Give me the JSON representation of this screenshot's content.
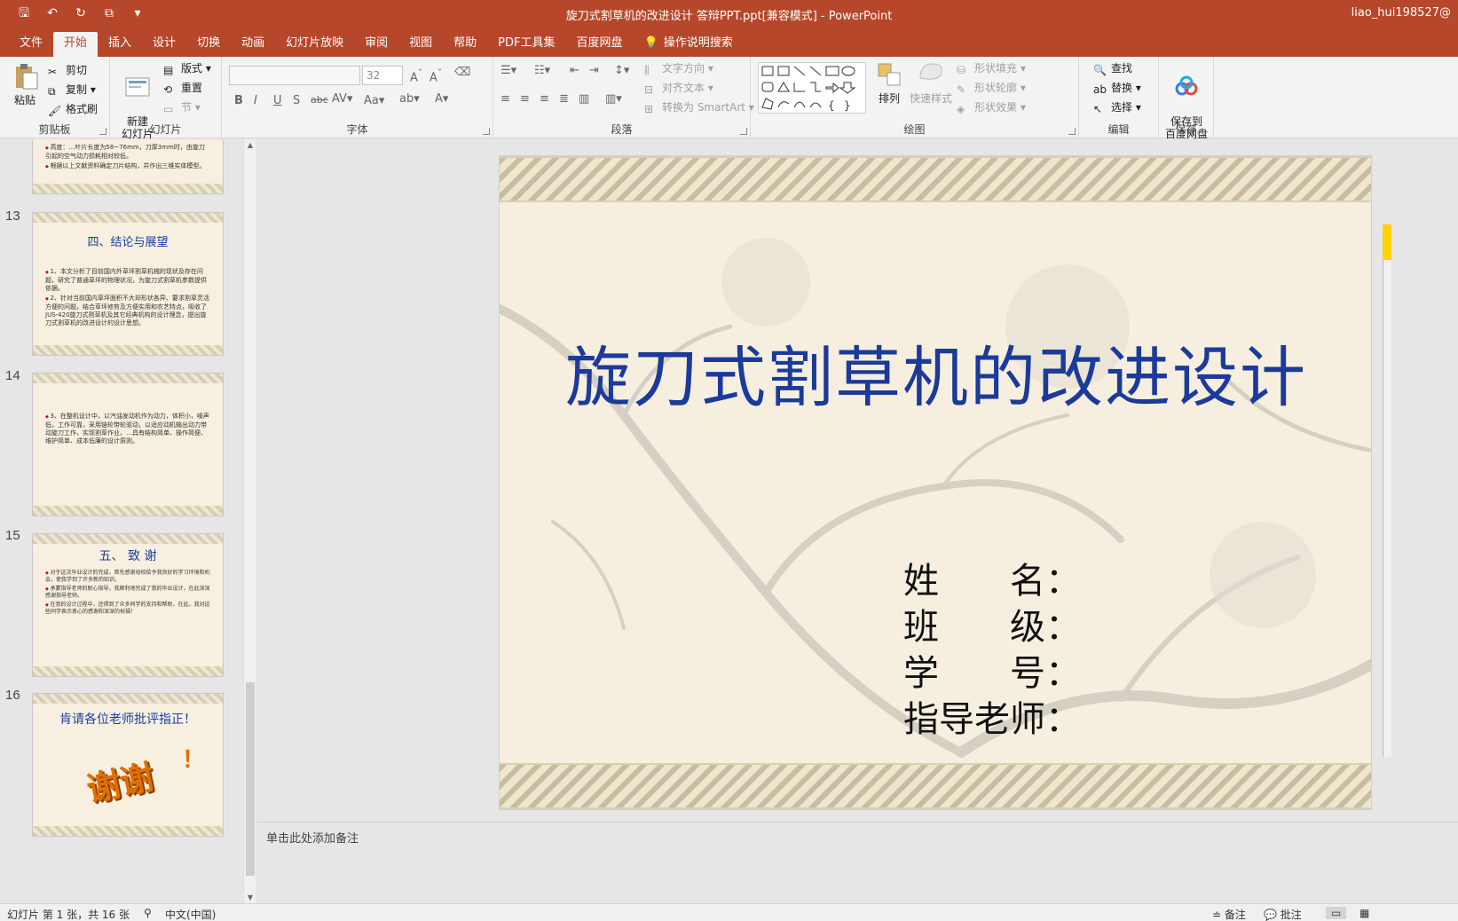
{
  "titlebar": {
    "title": "旋刀式割草机的改进设计 答辩PPT.ppt[兼容模式] - PowerPoint",
    "user": "liao_hui198527@"
  },
  "tabs": [
    {
      "label": "文件"
    },
    {
      "label": "开始"
    },
    {
      "label": "插入"
    },
    {
      "label": "设计"
    },
    {
      "label": "切换"
    },
    {
      "label": "动画"
    },
    {
      "label": "幻灯片放映"
    },
    {
      "label": "审阅"
    },
    {
      "label": "视图"
    },
    {
      "label": "帮助"
    },
    {
      "label": "PDF工具集"
    },
    {
      "label": "百度网盘"
    },
    {
      "label": "操作说明搜索"
    }
  ],
  "ribbon": {
    "clipboard": {
      "paste": "粘贴",
      "cut": "剪切",
      "copy": "复制",
      "format_painter": "格式刷",
      "label": "剪贴板"
    },
    "slides": {
      "new_slide": "新建\n幻灯片",
      "layout": "版式",
      "reset": "重置",
      "section": "节",
      "label": "幻灯片"
    },
    "font": {
      "size": "32",
      "label": "字体"
    },
    "paragraph": {
      "text_direction": "文字方向",
      "align_text": "对齐文本",
      "smartart": "转换为 SmartArt",
      "label": "段落"
    },
    "drawing": {
      "arrange": "排列",
      "quick_styles": "快速样式",
      "shape_fill": "形状填充",
      "shape_outline": "形状轮廓",
      "shape_effects": "形状效果",
      "label": "绘图"
    },
    "editing": {
      "find": "查找",
      "replace": "替换",
      "select": "选择",
      "label": "编辑"
    },
    "save": {
      "save_baidu": "保存到\n百度网盘",
      "label": "保存"
    }
  },
  "thumbnails": [
    {
      "number": "",
      "title": "",
      "body": [
        "高度：…叶片长度为58~76mm，刀厚3mm时，由旋刀引起的空气动力损耗相对较低。",
        "根据以上文献资料确定刀片结构，并作出三维实体模型。"
      ]
    },
    {
      "number": "13",
      "title": "四、结论与展望",
      "body": [
        "1、本文分析了目前国内外草坪割草机械的现状及存在问题，研究了普通草坪的物理状况，为旋刀式割草机参数提供依据。",
        "2、针对当前国内草坪面积不大却形状各异、要求割草灵活方便的问题，结合草坪修剪及方便实用和农艺特点，吸收了JUS-420旋刀式割草机及其它经典机构的设计理念，提出旋刀式割草机的改进设计的设计思想。"
      ]
    },
    {
      "number": "14",
      "title": "",
      "body": [
        "3、在整机设计中，以汽油发动机作为动力，体积小，噪声低，工作可靠，采用链轮带轮驱动，以适应动机输出动力带动旋刀工作，实现割草作业。…具有结构简单、操作简便、维护简单、成本低廉的设计原则。"
      ]
    },
    {
      "number": "15",
      "title": "五、 致 谢",
      "body": [
        "对于这次毕业设计的完成，首先感谢母校给予我良好的学习环境和机会，使我学到了许多新的知识。",
        "承蒙指导老师的耐心指导，我顺利地完成了我的毕业设计，在此深深感谢指导老师。",
        "在我的设计过程中，还得到了众多同学的支持和帮助，在此，我对这些同学表示衷心的感谢和深深的祝福！"
      ]
    },
    {
      "number": "16",
      "title": "肯请各位老师批评指正！",
      "body": [],
      "thanks": "谢谢",
      "excl": "！"
    }
  ],
  "slide": {
    "title": "旋刀式割草机的改进设计",
    "fields": [
      {
        "key": "姓　　名：",
        "value": ""
      },
      {
        "key": "班　　级：",
        "value": ""
      },
      {
        "key": "学　　号：",
        "value": ""
      },
      {
        "key": "指导老师：",
        "value": ""
      }
    ]
  },
  "notes": {
    "placeholder": "单击此处添加备注"
  },
  "status": {
    "slide_info": "幻灯片 第 1 张，共 16 张",
    "language": "中文(中国)",
    "notes_btn": "备注",
    "comments_btn": "批注"
  },
  "colors": {
    "accent": "#b7472a",
    "title_blue": "#1b3a9a",
    "slide_bg": "#f6efdf"
  }
}
